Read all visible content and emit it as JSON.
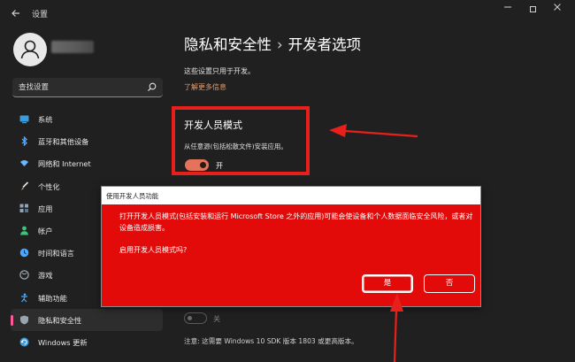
{
  "window": {
    "title": "设置",
    "controls": [
      "minimize",
      "maximize",
      "close"
    ]
  },
  "icons": {
    "back": "back-arrow-icon",
    "search": "search-icon",
    "user": "user-avatar-icon"
  },
  "sidebar": {
    "search_placeholder": "查找设置",
    "items": [
      {
        "label": "系统",
        "icon": "system-icon",
        "color": "#3a9bdc"
      },
      {
        "label": "蓝牙和其他设备",
        "icon": "bluetooth-icon",
        "color": "#4aa8ff"
      },
      {
        "label": "网络和 Internet",
        "icon": "network-icon",
        "color": "#6bb6ff"
      },
      {
        "label": "个性化",
        "icon": "brush-icon",
        "color": "#e2a45a"
      },
      {
        "label": "应用",
        "icon": "apps-icon",
        "color": "#8fa3b8"
      },
      {
        "label": "帐户",
        "icon": "account-icon",
        "color": "#3fc27a"
      },
      {
        "label": "时间和语言",
        "icon": "time-language-icon",
        "color": "#4aa8ff"
      },
      {
        "label": "游戏",
        "icon": "gaming-icon",
        "color": "#9aa4b0"
      },
      {
        "label": "辅助功能",
        "icon": "accessibility-icon",
        "color": "#4aa8ff"
      },
      {
        "label": "隐私和安全性",
        "icon": "shield-icon",
        "color": "#9aa4b0"
      },
      {
        "label": "Windows 更新",
        "icon": "windows-update-icon",
        "color": "#3a9bdc"
      }
    ],
    "active_index": 9
  },
  "main": {
    "breadcrumb_parent": "隐私和安全性",
    "breadcrumb_separator": "›",
    "breadcrumb_current": "开发者选项",
    "intro": "这些设置只用于开发。",
    "learn_more": "了解更多信息",
    "dev_mode": {
      "title": "开发人员模式",
      "description": "从任意源(包括松散文件)安装应用。",
      "toggle_state": "开"
    },
    "hidden_toggle_label": "关",
    "note": "注意: 这需要 Windows 10 SDK 版本 1803 或更高版本。"
  },
  "dialog": {
    "title": "使用开发人员功能",
    "message": "打开开发人员模式(包括安装和运行 Microsoft Store 之外的应用)可能会使设备和个人数据面临安全风险，或者对设备造成损害。",
    "question": "启用开发人员模式吗?",
    "yes_label": "是",
    "no_label": "否"
  },
  "colors": {
    "background": "#202020",
    "highlight_border": "#e8201c",
    "dialog_background": "#e30a0a",
    "toggle_on": "#e4735c",
    "link": "#e39b6d",
    "active_indicator": "#ff5a9a"
  }
}
